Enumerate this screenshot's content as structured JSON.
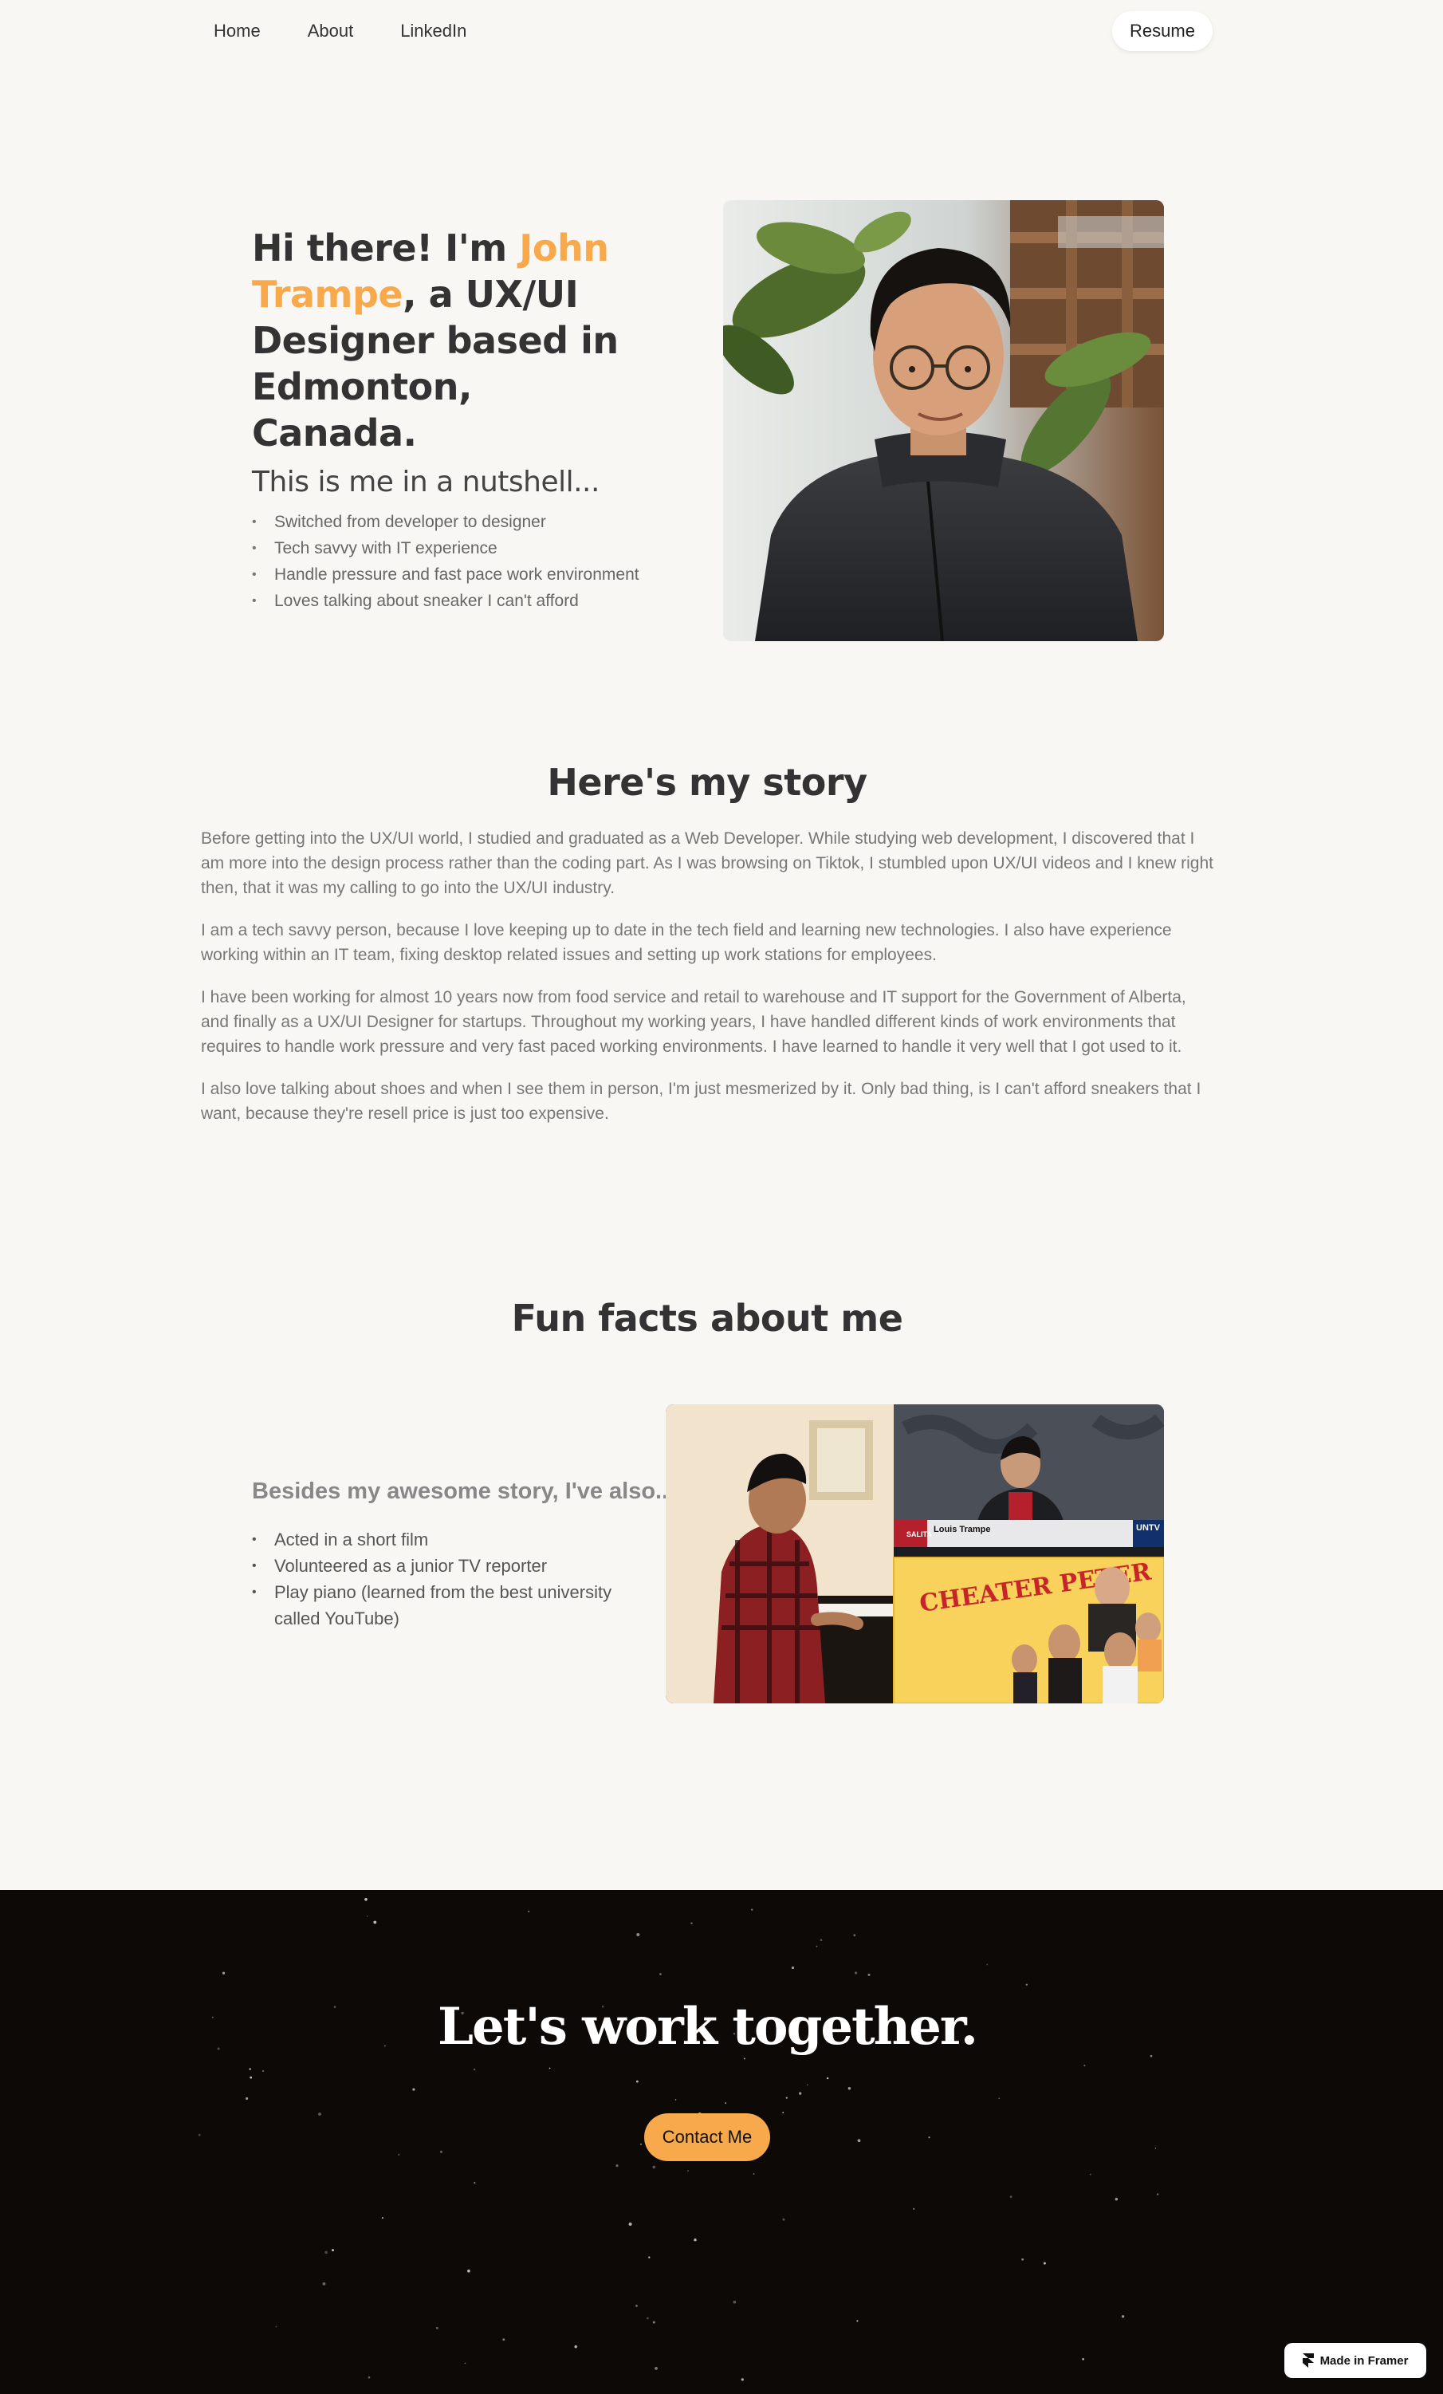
{
  "nav": {
    "links": [
      "Home",
      "About",
      "LinkedIn"
    ],
    "resume_label": "Resume"
  },
  "hero": {
    "title_prefix": "Hi there! I'm ",
    "name": "John Trampe",
    "title_suffix": ", a UX/UI Designer based in Edmonton, Canada.",
    "nutshell_heading": "This is me in a nutshell...",
    "nutshell_items": [
      "Switched from developer to designer",
      "Tech savvy with IT experience",
      "Handle pressure and fast pace work environment",
      "Loves talking about sneaker I can't afford"
    ]
  },
  "story": {
    "heading": "Here's my story",
    "paragraphs": [
      "Before getting into the UX/UI world, I studied and graduated as a Web Developer. While studying web development, I discovered that I am more into the design process rather than the coding part.  As I was browsing on Tiktok, I stumbled upon UX/UI videos and I knew right then, that it was my calling to go into the UX/UI industry.",
      "I am a tech savvy person, because I love keeping up to date in the tech field and learning new technologies. I also have experience working within an IT team, fixing desktop related issues and setting up work stations for employees.",
      "I have been working for almost 10 years now from food service and retail to warehouse and IT support for the Government of Alberta, and finally as a UX/UI Designer for startups. Throughout my working years, I have handled different kinds of work environments that requires to handle work pressure and very fast paced working environments. I have learned to handle it very well that I got used to it.",
      "I also love talking about shoes and when I see them in person, I'm just mesmerized by it. Only bad thing, is I can't afford sneakers that I want, because they're resell price is just too expensive."
    ]
  },
  "fun": {
    "heading": "Fun facts about me",
    "subheading": "Besides my awesome story, I've also...",
    "items": [
      "Acted in a short film",
      "Volunteered as a junior TV reporter",
      "Play piano (learned from the best university called YouTube)"
    ],
    "tv_caption": "Louis Trampe",
    "tv_logo": "UNTV",
    "poster_title": "CHEATER PETER"
  },
  "footer": {
    "cta_heading": "Let's work together.",
    "contact_label": "Contact Me",
    "badge_label": "Made in Framer"
  },
  "colors": {
    "accent": "#f7a94c",
    "background": "#f8f7f3",
    "footer_bg": "#0d0906"
  }
}
